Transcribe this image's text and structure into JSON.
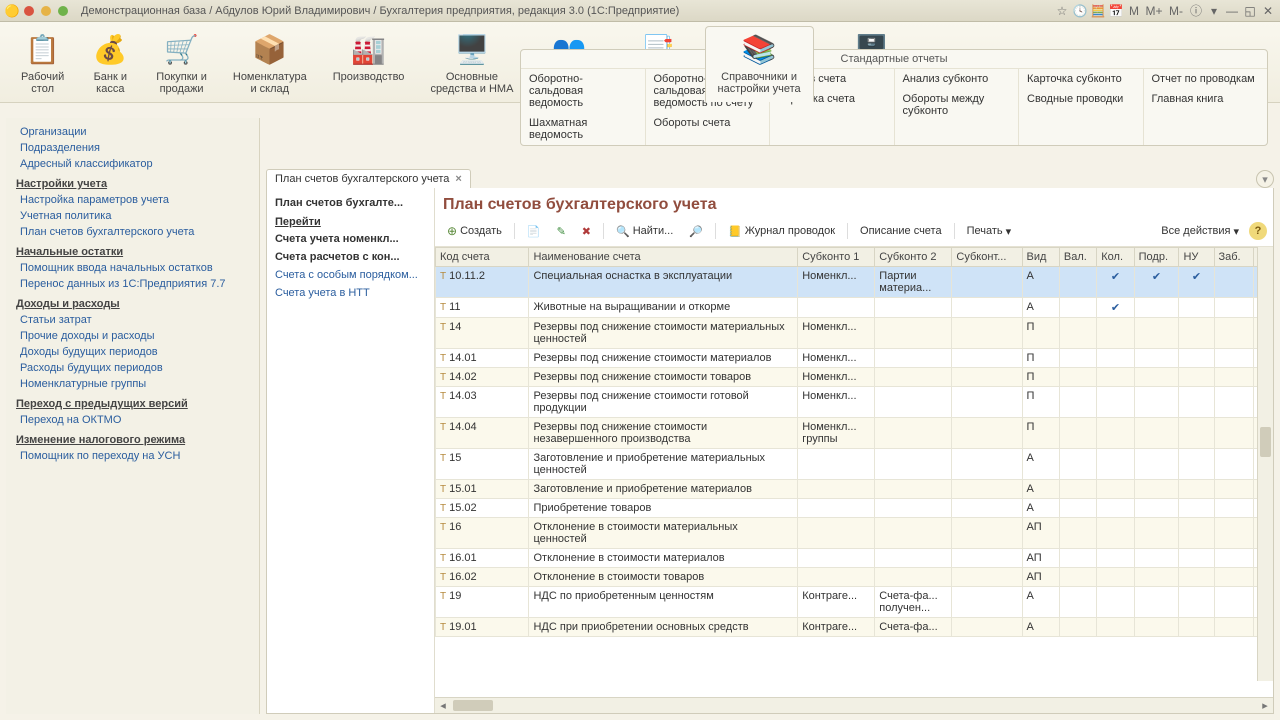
{
  "window": {
    "title": "Демонстрационная база / Абдулов Юрий Владимирович / Бухгалтерия предприятия, редакция 3.0  (1С:Предприятие)",
    "menu_letters": [
      "M",
      "M+",
      "M-"
    ]
  },
  "toolbar": [
    {
      "label": "Рабочий\nстол",
      "icon": "📋"
    },
    {
      "label": "Банк и\nкасса",
      "icon": "💰"
    },
    {
      "label": "Покупки и\nпродажи",
      "icon": "🛒"
    },
    {
      "label": "Номенклатура\nи склад",
      "icon": "📦"
    },
    {
      "label": "Производство",
      "icon": "🏭"
    },
    {
      "label": "Основные\nсредства и НМА",
      "icon": "🖥️"
    },
    {
      "label": "Сотрудники\nи зарплата",
      "icon": "👥"
    },
    {
      "label": "Учет, налоги,\nотчетность",
      "icon": "📑"
    },
    {
      "label": "Справочники и\nнастройки учета",
      "icon": "📚",
      "active": true
    },
    {
      "label": "Администрирование",
      "icon": "🗄️"
    }
  ],
  "reports": {
    "title": "Стандартные отчеты",
    "cols": [
      [
        "Оборотно-сальдовая ведомость",
        "Шахматная ведомость"
      ],
      [
        "Оборотно-сальдовая ведомость по счету",
        "Обороты счета"
      ],
      [
        "Анализ счета",
        "Карточка счета"
      ],
      [
        "Анализ субконто",
        "Обороты между субконто"
      ],
      [
        "Карточка субконто",
        "Сводные проводки"
      ],
      [
        "Отчет по проводкам",
        "Главная книга"
      ]
    ]
  },
  "sidebar": [
    {
      "type": "link",
      "label": "Организации"
    },
    {
      "type": "link",
      "label": "Подразделения"
    },
    {
      "type": "link",
      "label": "Адресный классификатор"
    },
    {
      "type": "group",
      "label": "Настройки учета"
    },
    {
      "type": "link",
      "label": "Настройка параметров учета"
    },
    {
      "type": "link",
      "label": "Учетная политика"
    },
    {
      "type": "link",
      "label": "План счетов бухгалтерского учета"
    },
    {
      "type": "group",
      "label": "Начальные остатки"
    },
    {
      "type": "link",
      "label": "Помощник ввода начальных остатков"
    },
    {
      "type": "link",
      "label": "Перенос данных из 1С:Предприятия 7.7"
    },
    {
      "type": "group",
      "label": "Доходы и расходы"
    },
    {
      "type": "link",
      "label": "Статьи затрат"
    },
    {
      "type": "link",
      "label": "Прочие доходы и расходы"
    },
    {
      "type": "link",
      "label": "Доходы будущих периодов"
    },
    {
      "type": "link",
      "label": "Расходы будущих периодов"
    },
    {
      "type": "link",
      "label": "Номенклатурные группы"
    },
    {
      "type": "group",
      "label": "Переход с предыдущих версий"
    },
    {
      "type": "link",
      "label": "Переход на ОКТМО"
    },
    {
      "type": "group",
      "label": "Изменение налогового режима"
    },
    {
      "type": "link",
      "label": "Помощник по переходу на УСН"
    }
  ],
  "tab": {
    "label": "План счетов бухгалтерского учета"
  },
  "subnav": [
    {
      "label": "План счетов бухгалте...",
      "bold": true
    },
    {
      "label": "Перейти",
      "head": true
    },
    {
      "label": "Счета учета номенкл...",
      "bold": true
    },
    {
      "label": "Счета расчетов с кон...",
      "bold": true
    },
    {
      "label": "Счета с особым порядком..."
    },
    {
      "label": "Счета учета в НТТ"
    }
  ],
  "page": {
    "title": "План счетов бухгалтерского учета",
    "create": "Создать",
    "find": "Найти...",
    "journal": "Журнал проводок",
    "desc": "Описание счета",
    "print": "Печать",
    "all_actions": "Все действия"
  },
  "columns": [
    "Код счета",
    "Наименование счета",
    "Субконто 1",
    "Субконто 2",
    "Субконт...",
    "Вид",
    "Вал.",
    "Кол.",
    "Подр.",
    "НУ",
    "Заб."
  ],
  "rows": [
    {
      "sel": true,
      "code": "10.11.2",
      "name": "Специальная оснастка в эксплуатации",
      "s1": "Номенкл...",
      "s2": "Партии материа...",
      "vid": "А",
      "kol": "✔",
      "podr": "✔",
      "nu": "✔"
    },
    {
      "code": "11",
      "name": "Животные на выращивании и откорме",
      "vid": "А",
      "kol": "✔"
    },
    {
      "alt": true,
      "code": "14",
      "name": "Резервы под снижение стоимости материальных ценностей",
      "s1": "Номенкл...",
      "vid": "П"
    },
    {
      "code": "14.01",
      "name": "Резервы под снижение стоимости материалов",
      "s1": "Номенкл...",
      "vid": "П"
    },
    {
      "alt": true,
      "code": "14.02",
      "name": "Резервы под снижение стоимости товаров",
      "s1": "Номенкл...",
      "vid": "П"
    },
    {
      "code": "14.03",
      "name": "Резервы под снижение стоимости готовой продукции",
      "s1": "Номенкл...",
      "vid": "П"
    },
    {
      "alt": true,
      "code": "14.04",
      "name": "Резервы под снижение стоимости незавершенного производства",
      "s1": "Номенкл... группы",
      "vid": "П"
    },
    {
      "code": "15",
      "name": "Заготовление и приобретение материальных ценностей",
      "vid": "А"
    },
    {
      "alt": true,
      "code": "15.01",
      "name": "Заготовление и приобретение материалов",
      "vid": "А"
    },
    {
      "code": "15.02",
      "name": "Приобретение товаров",
      "vid": "А"
    },
    {
      "alt": true,
      "code": "16",
      "name": "Отклонение в стоимости материальных ценностей",
      "vid": "АП"
    },
    {
      "code": "16.01",
      "name": "Отклонение в стоимости материалов",
      "vid": "АП"
    },
    {
      "alt": true,
      "code": "16.02",
      "name": "Отклонение в стоимости товаров",
      "vid": "АП"
    },
    {
      "code": "19",
      "name": "НДС по приобретенным ценностям",
      "s1": "Контраге...",
      "s2": "Счета-фа... получен...",
      "vid": "А"
    },
    {
      "alt": true,
      "code": "19.01",
      "name": "НДС при приобретении основных средств",
      "s1": "Контраге...",
      "s2": "Счета-фа...",
      "vid": "А"
    }
  ]
}
